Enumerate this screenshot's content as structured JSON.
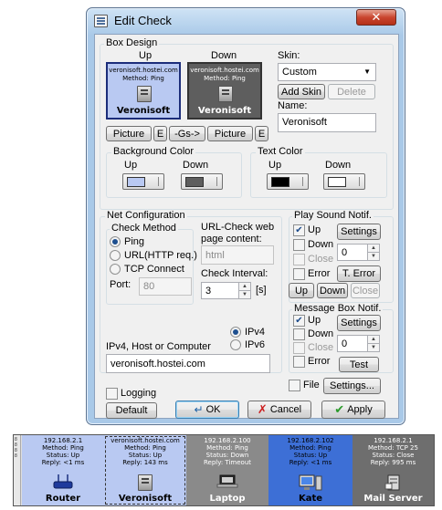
{
  "window": {
    "title": "Edit Check",
    "close_symbol": "✕"
  },
  "box_design": {
    "legend": "Box Design",
    "up_label": "Up",
    "down_label": "Down",
    "preview_up": {
      "host": "veronisoft.hostei.com",
      "method": "Method: Ping",
      "name": "Veronisoft",
      "bg": "#b9c9f2",
      "fg": "#000000"
    },
    "preview_down": {
      "host": "veronisoft.hostei.com",
      "method": "Method: Ping",
      "name": "Veronisoft",
      "bg": "#5e5e5e",
      "fg": "#ffffff"
    },
    "picture_up_button": "Picture",
    "edit_up_button": "E",
    "gs_button": "-Gs->",
    "picture_down_button": "Picture",
    "edit_down_button": "E",
    "skin_label": "Skin:",
    "skin_value": "Custom",
    "add_skin_button": "Add Skin",
    "delete_button": "Delete",
    "name_label": "Name:",
    "name_value": "Veronisoft",
    "background_color": {
      "legend": "Background Color",
      "up": "Up",
      "down": "Down",
      "up_color": "#b9c9f2",
      "down_color": "#5e5e5e"
    },
    "text_color": {
      "legend": "Text Color",
      "up": "Up",
      "down": "Down",
      "up_color": "#000000",
      "down_color": "#ffffff"
    }
  },
  "net_config": {
    "legend": "Net Configuration",
    "check_method_legend": "Check Method",
    "methods": [
      "Ping",
      "URL(HTTP req.)",
      "TCP Connect"
    ],
    "selected_method": "Ping",
    "port_label": "Port:",
    "port_value": "80",
    "url_check_label": "URL-Check web page content:",
    "url_check_value": "html",
    "interval_label": "Check Interval:",
    "interval_value": "3",
    "interval_unit": "[s]",
    "ipv4_label": "IPv4",
    "ipv6_label": "IPv6",
    "host_label": "IPv4, Host or Computer",
    "host_value": "veronisoft.hostei.com"
  },
  "sound": {
    "legend": "Play Sound Notif.",
    "up_label": "Up",
    "down_label": "Down",
    "close_label": "Close",
    "error_label": "Error",
    "settings_button": "Settings",
    "spin_value": "0",
    "terror_button": "T. Error",
    "test_up_button": "Up",
    "test_down_button": "Down",
    "test_close_button": "Close"
  },
  "msgbox": {
    "legend": "Message Box Notif.",
    "up_label": "Up",
    "down_label": "Down",
    "close_label": "Close",
    "error_label": "Error",
    "settings_button": "Settings",
    "spin_value": "0",
    "test_button": "Test"
  },
  "file": {
    "label": "File",
    "settings_button": "Settings..."
  },
  "footer": {
    "logging_label": "Logging",
    "default_button": "Default",
    "ok_button": "OK",
    "cancel_button": "Cancel",
    "apply_button": "Apply"
  },
  "grip": {
    "text": [
      "8",
      "8",
      "8",
      "8"
    ]
  },
  "tiles": [
    {
      "ip": "192.168.2.1",
      "method": "Method: Ping",
      "status": "Status: Up",
      "reply": "Reply: <1 ms",
      "name": "Router",
      "bg": "#b9c9f2",
      "fg": "#000000",
      "icon": "router-icon"
    },
    {
      "ip": "veronisoft.hostei.com",
      "method": "Method: Ping",
      "status": "Status: Up",
      "reply": "Reply: 143 ms",
      "name": "Veronisoft",
      "bg": "#b9c9f2",
      "fg": "#000000",
      "icon": "computer-icon"
    },
    {
      "ip": "192.168.2.100",
      "method": "Method: Ping",
      "status": "Status: Down",
      "reply": "Reply: Timeout",
      "name": "Laptop",
      "bg": "#8a8a8a",
      "fg": "#ffffff",
      "icon": "laptop-icon"
    },
    {
      "ip": "192.168.2.102",
      "method": "Method: Ping",
      "status": "Status: Up",
      "reply": "Reply: <1 ms",
      "name": "Kate",
      "bg": "#3d6fd6",
      "fg": "#000000",
      "icon": "desktop-icon"
    },
    {
      "ip": "192.168.2.1",
      "method": "Method: TCP 25",
      "status": "Status: Close",
      "reply": "Reply: 995 ms",
      "name": "Mail Server",
      "bg": "#6e6e6e",
      "fg": "#ffffff",
      "icon": "server-icon"
    }
  ]
}
